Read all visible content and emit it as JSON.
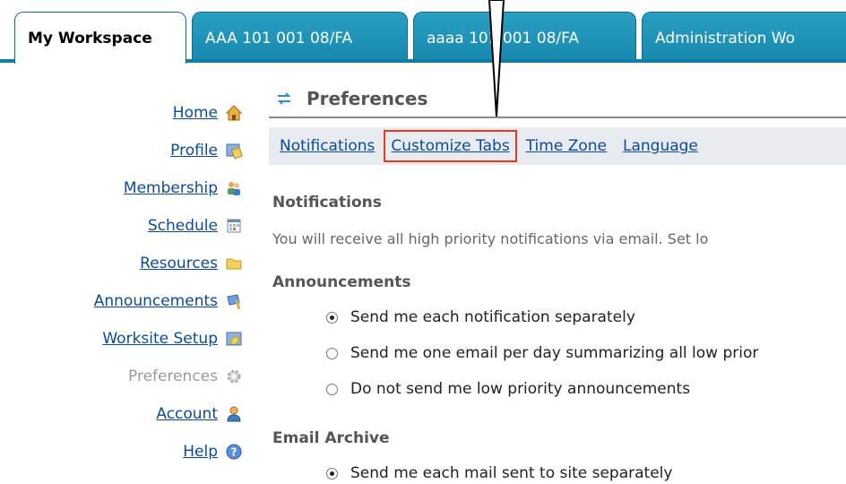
{
  "tabs": [
    {
      "label": "My Workspace",
      "active": true
    },
    {
      "label": "AAA 101 001 08/FA",
      "active": false
    },
    {
      "label": "aaaa 101 001 08/FA",
      "active": false
    },
    {
      "label": "Administration Wo",
      "active": false
    }
  ],
  "leftnav": {
    "items": [
      {
        "label": "Home",
        "icon": "home-icon"
      },
      {
        "label": "Profile",
        "icon": "profile-icon"
      },
      {
        "label": "Membership",
        "icon": "membership-icon"
      },
      {
        "label": "Schedule",
        "icon": "calendar-icon"
      },
      {
        "label": "Resources",
        "icon": "folder-icon"
      },
      {
        "label": "Announcements",
        "icon": "announcement-icon"
      },
      {
        "label": "Worksite Setup",
        "icon": "worksite-setup-icon"
      },
      {
        "label": "Preferences",
        "icon": "gear-icon",
        "current": true
      },
      {
        "label": "Account",
        "icon": "account-icon"
      },
      {
        "label": "Help",
        "icon": "help-icon"
      }
    ]
  },
  "main": {
    "title": "Preferences",
    "subnav": [
      "Notifications",
      "Customize Tabs",
      "Time Zone",
      "Language"
    ],
    "highlighted_subnav": "Customize Tabs",
    "notifications_heading": "Notifications",
    "notifications_intro": "You will receive all high priority notifications via email. Set lo",
    "announcements_heading": "Announcements",
    "announcements_options": [
      "Send me each notification separately",
      "Send me one email per day summarizing all low prior",
      "Do not send me low priority announcements"
    ],
    "announcements_selected": 0,
    "email_archive_heading": "Email Archive",
    "email_archive_options": [
      "Send me each mail sent to site separately"
    ],
    "email_archive_selected": 0
  },
  "colors": {
    "tab_bg": "#1788ad",
    "link": "#0a4a9c",
    "highlight_box": "#e53a1f"
  }
}
